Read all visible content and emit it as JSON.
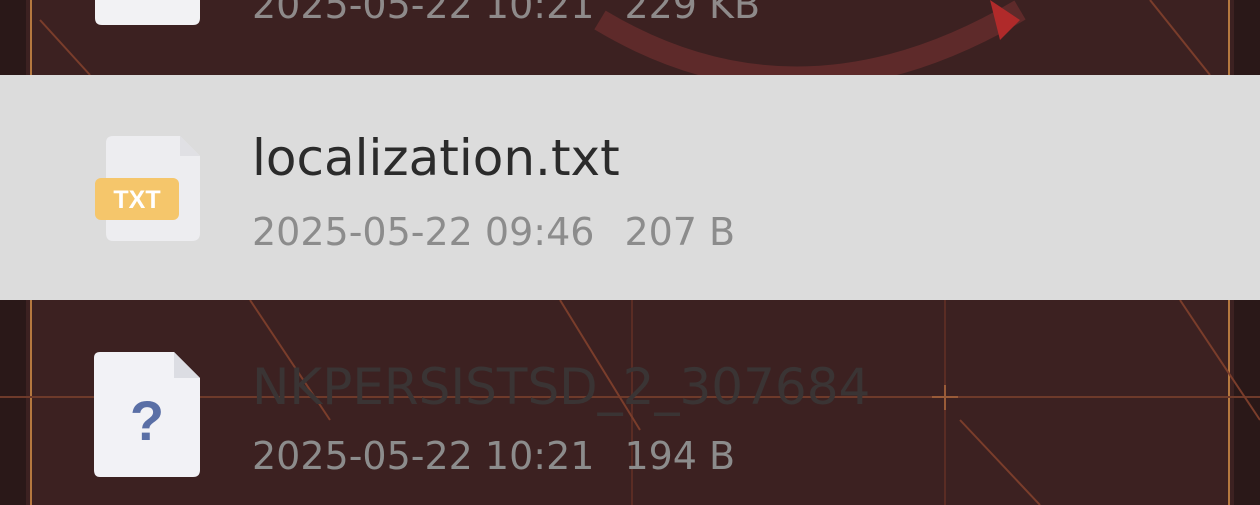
{
  "files": [
    {
      "date": "2025-05-22 10:21",
      "size": "229 KB",
      "icon": "blank-file-icon"
    },
    {
      "name": "localization.txt",
      "date": "2025-05-22 09:46",
      "size": "207 B",
      "icon": "txt-file-icon",
      "badge": "TXT",
      "selected": true
    },
    {
      "name": "NKPERSISTSD_2_307684",
      "date": "2025-05-22 10:21",
      "size": "194 B",
      "icon": "unknown-file-icon",
      "glyph": "?"
    }
  ],
  "colors": {
    "selected_row": "#dcdcdc",
    "background": "#3c2121",
    "txt_badge": "#f5c66b",
    "meta_text": "#8c8c8c",
    "unknown_glyph": "#5a6fa6"
  }
}
